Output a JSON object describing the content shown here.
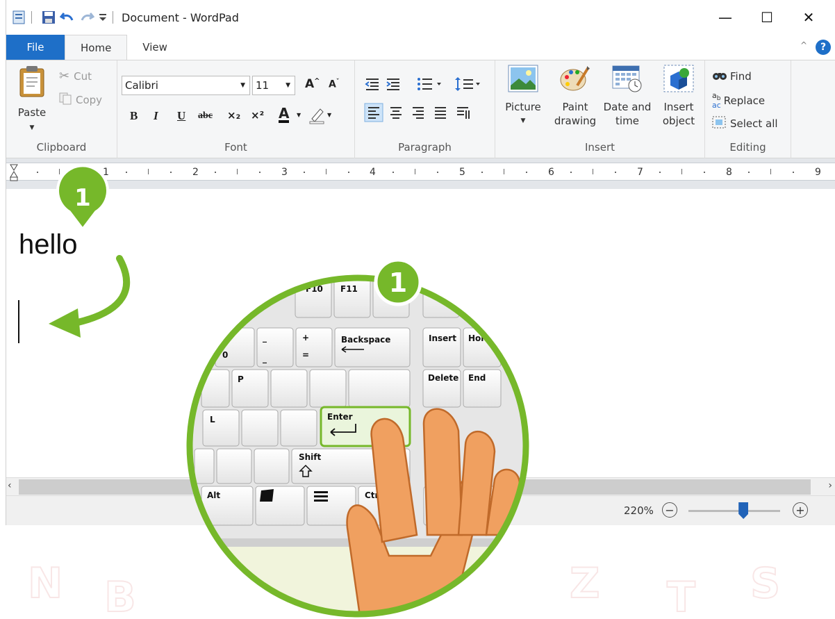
{
  "window": {
    "title": "Document - WordPad",
    "quick_access": [
      "save-icon",
      "undo-icon",
      "redo-icon",
      "customize-icon"
    ],
    "controls": {
      "minimize": "—",
      "maximize": "☐",
      "close": "✕"
    }
  },
  "tabs": [
    "File",
    "Home",
    "View"
  ],
  "ribbon": {
    "clipboard": {
      "label": "Clipboard",
      "paste": "Paste",
      "cut": "Cut",
      "copy": "Copy"
    },
    "font": {
      "label": "Font",
      "family": "Calibri",
      "size": "11",
      "bold": "B",
      "italic": "I",
      "underline": "U",
      "strike": "abc",
      "subscript": "×₂",
      "superscript": "×²",
      "color_letter": "A"
    },
    "paragraph": {
      "label": "Paragraph"
    },
    "insert": {
      "label": "Insert",
      "picture": "Picture",
      "paint_line1": "Paint",
      "paint_line2": "drawing",
      "date_line1": "Date and",
      "date_line2": "time",
      "object_line1": "Insert",
      "object_line2": "object"
    },
    "editing": {
      "label": "Editing",
      "find": "Find",
      "replace": "Replace",
      "select_all": "Select all"
    }
  },
  "ruler": {
    "numbers": [
      "1",
      "2",
      "3",
      "4",
      "5",
      "6",
      "7",
      "8",
      "9"
    ]
  },
  "document": {
    "text": "hello"
  },
  "statusbar": {
    "zoom": "220%",
    "zoom_level": 0.6
  },
  "illustration": {
    "step_badge": "1",
    "keyboard_keys": {
      "f10": "F10",
      "f11": "F11",
      "zero": "0",
      "minus": "−",
      "underscore": "_",
      "plus": "+",
      "equals": "=",
      "backspace": "Backspace",
      "insert": "Insert",
      "home": "Hor",
      "p": "P",
      "delete": "Delete",
      "end": "End",
      "l": "L",
      "enter": "Enter",
      "shift": "Shift",
      "alt": "Alt",
      "ctrl": "Ctrl"
    },
    "colors": {
      "green": "#76b82a",
      "green_dark": "#5e9a1c",
      "finger": "#f0a060",
      "finger_outline": "#c06a2a"
    }
  }
}
